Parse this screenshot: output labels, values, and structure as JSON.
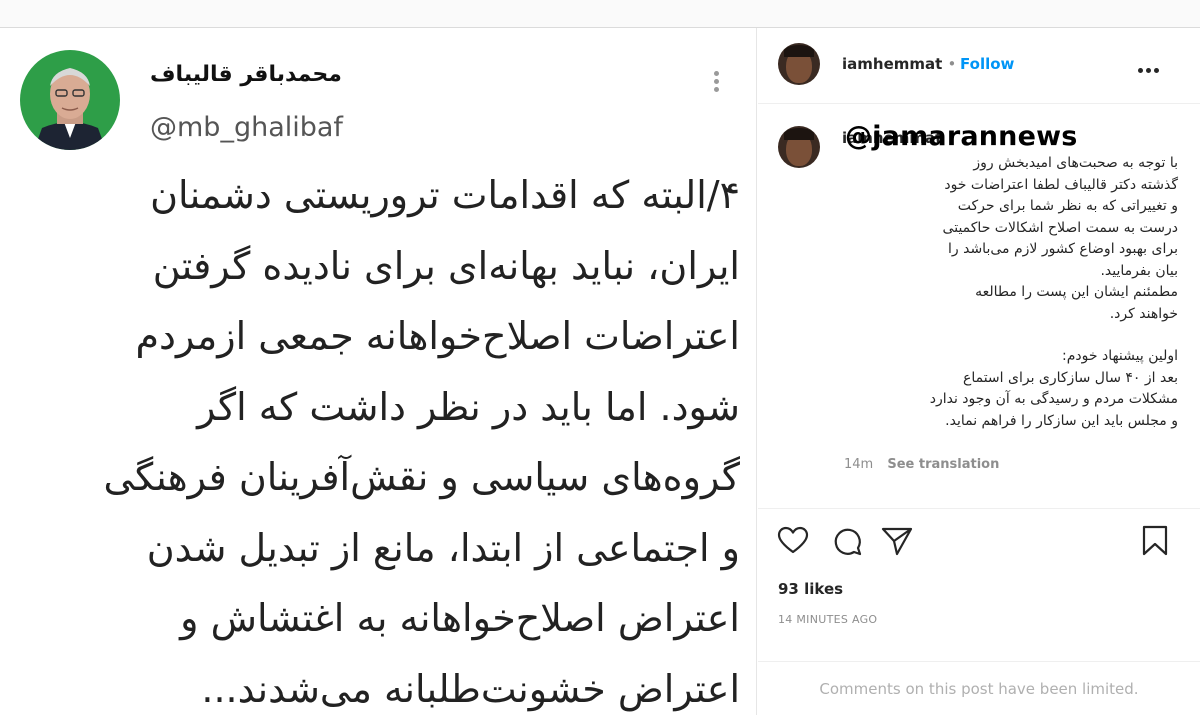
{
  "tweet": {
    "author_name": "محمدباقر قالیباف",
    "handle": "@mb_ghalibaf",
    "lines": [
      "۴/البته که اقدامات تروریستی دشمنان",
      "ایران، نباید بهانه‌ای برای نادیده گرفتن",
      "اعتراضات اصلاح‌خواهانه جمعی ازمردم",
      "شود. اما باید در نظر داشت که اگر",
      "گروه‌های سیاسی و نقش‌آفرینان فرهنگی",
      "و اجتماعی از ابتدا، مانع از تبدیل شدن",
      "اعتراض اصلاح‌خواهانه به اغتشاش و",
      "اعتراض خشونت‌طلبانه می‌شدند..."
    ]
  },
  "instagram": {
    "username": "iamhemmat",
    "dot": "•",
    "follow_label": "Follow",
    "caption_username": "iamhemmat",
    "caption_lines": [
      "با توجه به صحبت‌های امیدبخش روز",
      "گذشته دکتر قالیباف لطفا اعتراضات خود",
      "و تغییراتی که به نظر شما برای حرکت",
      "درست به سمت اصلاح اشکالات حاکمیتی",
      "برای بهبود اوضاع کشور لازم می‌باشد را",
      "بیان بفرمایید.",
      "مطمئنم ایشان این پست را مطالعه",
      "خواهند کرد."
    ],
    "caption_lines_2": [
      "اولین پیشنهاد خودم:",
      "بعد از ۴۰ سال سازکاری برای استماع",
      "مشکلات مردم و رسیدگی به آن وجود ندارد",
      "و مجلس باید این سازکار را فراهم نماید."
    ],
    "age": "14m",
    "see_translation": "See translation",
    "likes": "93 likes",
    "time_ago": "14 MINUTES AGO",
    "comments_limited": "Comments on this post have been limited."
  },
  "watermark": "@jamarannews",
  "icons": [
    "heart-icon",
    "comment-icon",
    "share-icon",
    "bookmark-icon",
    "more-icon"
  ],
  "colors": {
    "link": "#0095f6",
    "avatar_bg": "#2e9e48",
    "text": "#262626",
    "muted": "#8e8e8e"
  }
}
